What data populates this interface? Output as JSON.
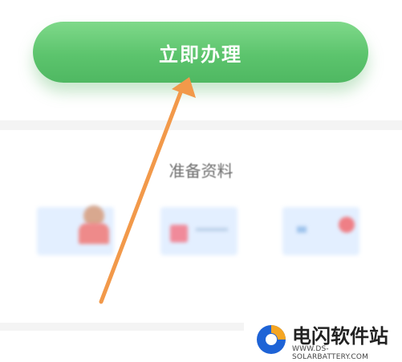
{
  "action": {
    "primary_button": "立即办理"
  },
  "materials": {
    "title": "准备资料",
    "items": [
      {
        "icon": "id-card-icon",
        "label": ""
      },
      {
        "icon": "document-icon",
        "label": ""
      },
      {
        "icon": "certificate-icon",
        "label": ""
      }
    ]
  },
  "colors": {
    "button_green": "#5cc46d",
    "arrow_orange": "#f2994a"
  },
  "watermark": {
    "title": "电闪软件站",
    "url": "WWW.DS-SOLARBATTERY.COM"
  }
}
